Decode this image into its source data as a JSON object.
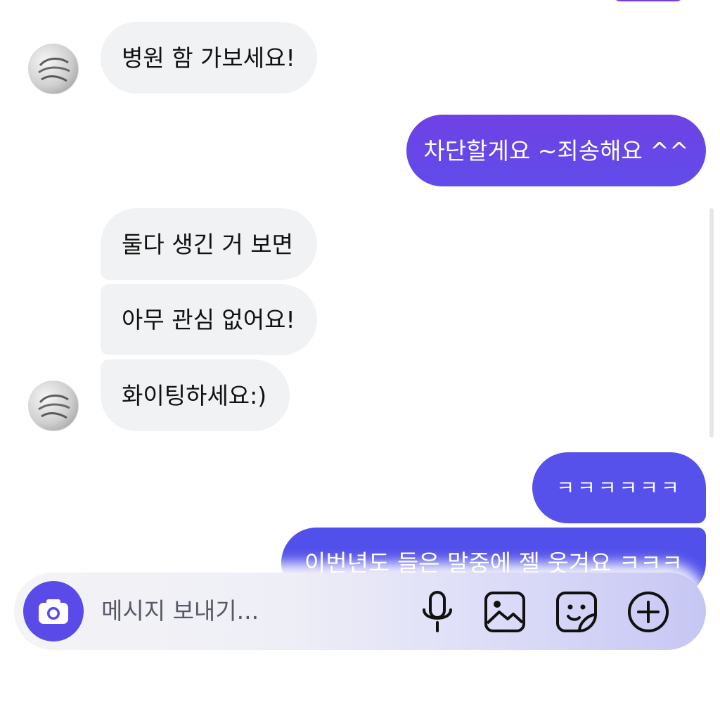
{
  "messages": [
    {
      "direction": "incoming",
      "text": "병원 함 가보세요!"
    },
    {
      "direction": "outgoing",
      "text": "차단할게요 ~죄송해요 ^^"
    },
    {
      "direction": "incoming",
      "text": "둘다 생긴 거 보면"
    },
    {
      "direction": "incoming",
      "text": "아무 관심 없어요!"
    },
    {
      "direction": "incoming",
      "text": "화이팅하세요:)"
    },
    {
      "direction": "outgoing",
      "text": "ㅋㅋㅋㅋㅋㅋ"
    },
    {
      "direction": "outgoing",
      "text": "이번년도 들은 말중에 젤 웃겨요 ㅋㅋㅋ"
    }
  ],
  "composer": {
    "placeholder": "메시지 보내기...",
    "buttons": [
      "camera-icon",
      "microphone-icon",
      "image-icon",
      "sticker-icon",
      "add-icon"
    ]
  },
  "colors": {
    "incoming_bubble": "#f1f2f4",
    "outgoing_gradient_top": "#7a3fe0",
    "outgoing_gradient_bottom": "#4f4eea",
    "camera_button": "#5a4ae8"
  }
}
